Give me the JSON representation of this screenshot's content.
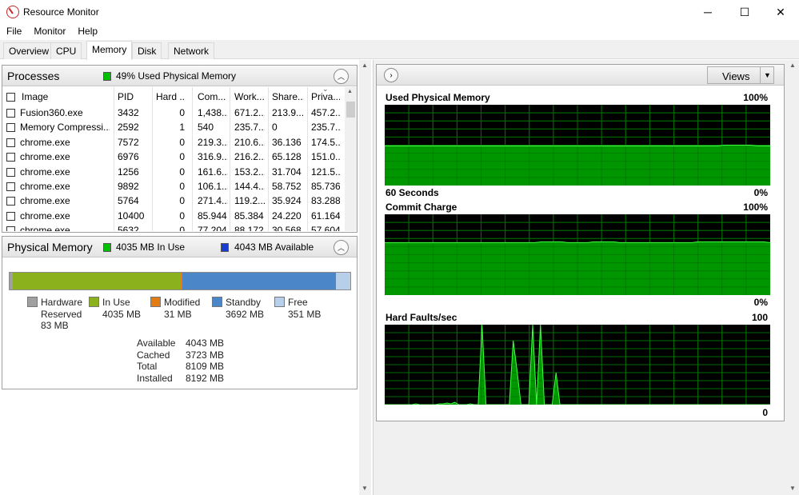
{
  "window": {
    "title": "Resource Monitor",
    "minimize_glyph": "─",
    "maximize_glyph": "☐",
    "close_glyph": "✕"
  },
  "menu": [
    "File",
    "Monitor",
    "Help"
  ],
  "tabs": [
    "Overview",
    "CPU",
    "Memory",
    "Disk",
    "Network"
  ],
  "active_tab": "Memory",
  "processes": {
    "title": "Processes",
    "summary": "49% Used Physical Memory",
    "summary_color": "#00c000",
    "columns": [
      "Image",
      "PID",
      "Hard ...",
      "Com...",
      "Work...",
      "Share...",
      "Priva..."
    ],
    "rows": [
      [
        "Fusion360.exe",
        "3432",
        "0",
        "1,438...",
        "671.2...",
        "213.9...",
        "457.2..."
      ],
      [
        "Memory Compressi...",
        "2592",
        "1",
        "540",
        "235.7...",
        "0",
        "235.7..."
      ],
      [
        "chrome.exe",
        "7572",
        "0",
        "219.3...",
        "210.6...",
        "36.136",
        "174.5..."
      ],
      [
        "chrome.exe",
        "6976",
        "0",
        "316.9...",
        "216.2...",
        "65.128",
        "151.0..."
      ],
      [
        "chrome.exe",
        "1256",
        "0",
        "161.6...",
        "153.2...",
        "31.704",
        "121.5..."
      ],
      [
        "chrome.exe",
        "9892",
        "0",
        "106.1...",
        "144.4...",
        "58.752",
        "85.736"
      ],
      [
        "chrome.exe",
        "5764",
        "0",
        "271.4...",
        "119.2...",
        "35.924",
        "83.288"
      ],
      [
        "chrome.exe",
        "10400",
        "0",
        "85.944",
        "85.384",
        "24.220",
        "61.164"
      ],
      [
        "chrome.exe",
        "5632",
        "0",
        "77.204",
        "88.172",
        "30.568",
        "57.604"
      ]
    ]
  },
  "physical_memory": {
    "title": "Physical Memory",
    "in_use_label": "4035 MB In Use",
    "available_label": "4043 MB Available",
    "in_use_color": "#00c000",
    "available_color": "#1a3cd0",
    "bar": [
      {
        "key": "hardware",
        "mb": 83,
        "color": "#a0a0a0"
      },
      {
        "key": "in_use",
        "mb": 4035,
        "color": "#8bb11d"
      },
      {
        "key": "modified",
        "mb": 31,
        "color": "#e37a12"
      },
      {
        "key": "standby",
        "mb": 3692,
        "color": "#4a86c8"
      },
      {
        "key": "free",
        "mb": 351,
        "color": "#b7cfe8"
      }
    ],
    "legend": [
      {
        "label": "Hardware\nReserved\n83 MB",
        "color": "#a0a0a0"
      },
      {
        "label": "In Use\n4035 MB",
        "color": "#8bb11d"
      },
      {
        "label": "Modified\n31 MB",
        "color": "#e37a12"
      },
      {
        "label": "Standby\n3692 MB",
        "color": "#4a86c8"
      },
      {
        "label": "Free\n351 MB",
        "color": "#b7cfe8"
      }
    ],
    "stats": [
      {
        "label": "Available",
        "value": "4043 MB"
      },
      {
        "label": "Cached",
        "value": "3723 MB"
      },
      {
        "label": "Total",
        "value": "8109 MB"
      },
      {
        "label": "Installed",
        "value": "8192 MB"
      }
    ]
  },
  "graphs_panel": {
    "views_label": "Views",
    "graphs": [
      {
        "title": "Used Physical Memory",
        "max_label": "100%",
        "min_label": "0%",
        "time_label": "60 Seconds",
        "fill_color": "#00b000",
        "line_color": "#40ff40",
        "points": [
          49,
          49,
          49,
          49,
          49,
          49,
          49,
          49,
          49,
          49,
          49,
          49,
          49,
          49,
          49,
          49,
          49,
          49,
          49,
          49,
          49,
          49,
          49,
          49,
          49,
          49,
          49,
          49,
          49,
          49,
          49,
          49,
          49,
          49,
          49,
          49,
          49,
          49,
          49,
          49,
          49,
          49,
          49,
          49,
          49,
          49,
          49,
          49,
          49,
          49,
          49,
          49,
          50,
          50,
          50,
          50,
          50,
          49,
          49,
          49
        ]
      },
      {
        "title": "Commit Charge",
        "max_label": "100%",
        "min_label": "0%",
        "time_label": "",
        "fill_color": "#00b000",
        "line_color": "#40ff40",
        "points": [
          65,
          65,
          65,
          65,
          65,
          65,
          65,
          65,
          65,
          65,
          65,
          65,
          65,
          65,
          65,
          65,
          65,
          65,
          65,
          65,
          65,
          65,
          65,
          65,
          66,
          66,
          66,
          66,
          65,
          65,
          65,
          65,
          66,
          66,
          66,
          66,
          65,
          65,
          65,
          65,
          65,
          65,
          65,
          65,
          65,
          65,
          65,
          65,
          66,
          66,
          66,
          66,
          66,
          66,
          66,
          66,
          66,
          66,
          66,
          65
        ]
      },
      {
        "title": "Hard Faults/sec",
        "max_label": "100",
        "min_label": "0",
        "time_label": "",
        "fill_color": "#00b000",
        "line_color": "#40ff40",
        "points": [
          0,
          0,
          0,
          0,
          0,
          0,
          0,
          0,
          1,
          0,
          0,
          0,
          0,
          0,
          1,
          1,
          2,
          1,
          3,
          0,
          0,
          0,
          1,
          0,
          0,
          100,
          0,
          0,
          0,
          0,
          0,
          0,
          0,
          80,
          42,
          0,
          0,
          0,
          100,
          0,
          100,
          0,
          0,
          0,
          40,
          0,
          0,
          0,
          0,
          0,
          0,
          0,
          0,
          0,
          0,
          0,
          0,
          0,
          0,
          0,
          0,
          0,
          0,
          0,
          0,
          0,
          0,
          0,
          0,
          0,
          0,
          0,
          0,
          0,
          0,
          0,
          0,
          0,
          0,
          0,
          0,
          0,
          0,
          0,
          0,
          0,
          0,
          0,
          0,
          0,
          0,
          0,
          0,
          0,
          0,
          0,
          0,
          0,
          0,
          0
        ]
      }
    ]
  }
}
